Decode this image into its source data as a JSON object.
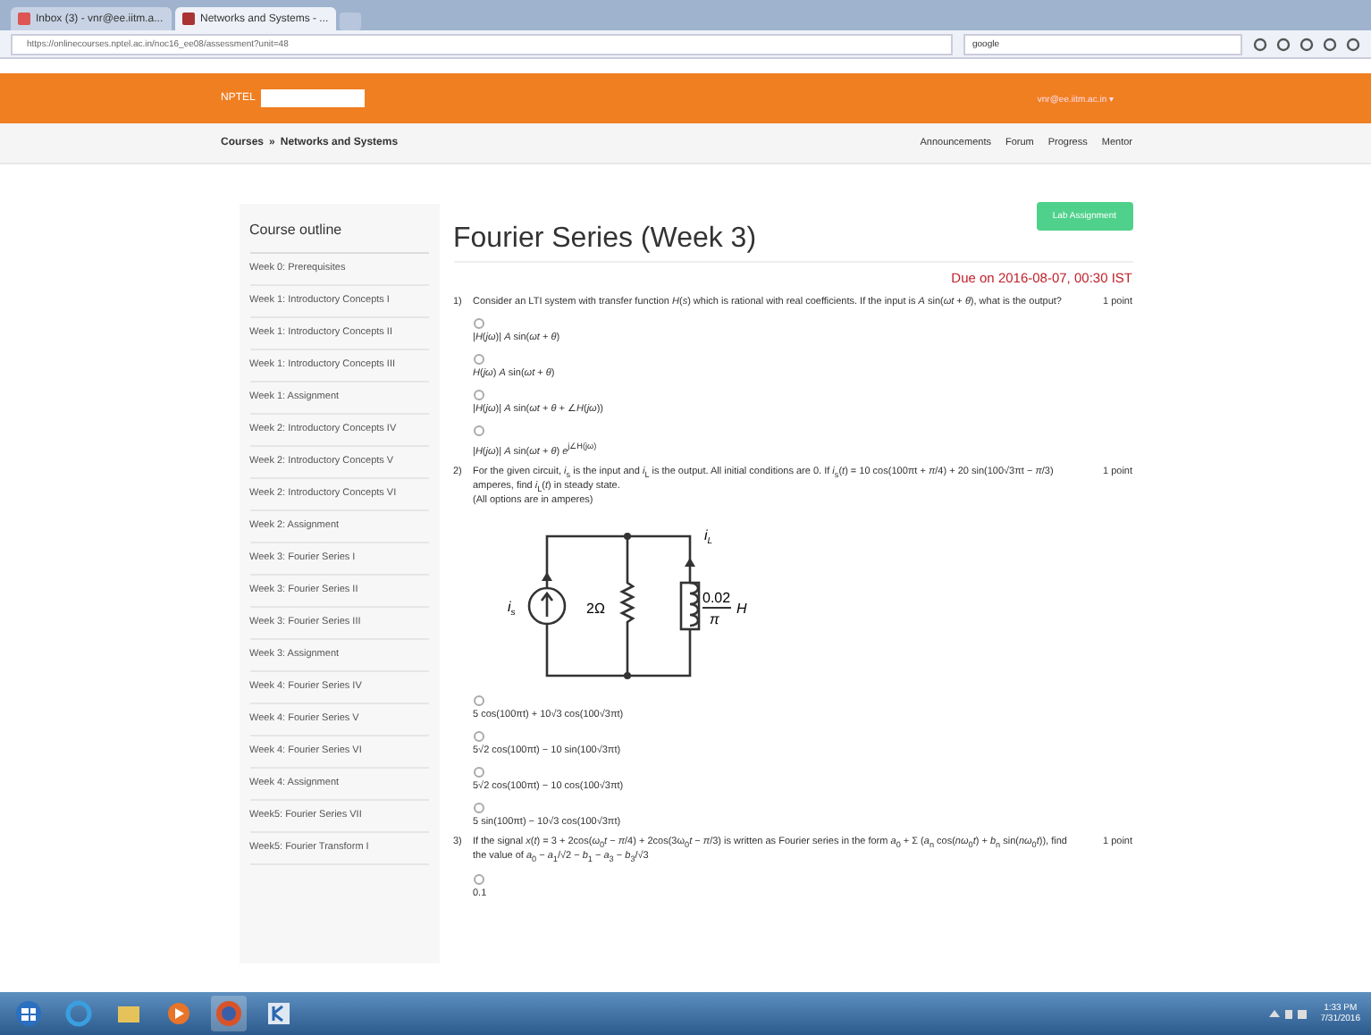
{
  "browser": {
    "tabs": [
      {
        "label": "Inbox (3) - vnr@ee.iitm.a...",
        "selected": false
      },
      {
        "label": "Networks and Systems - ...",
        "selected": true
      }
    ],
    "address": "https://onlinecourses.nptel.ac.in/noc16_ee08/assessment?unit=48",
    "search": "google"
  },
  "site": {
    "brand": "NPTEL",
    "user": "vnr@ee.iitm.ac.in ▾",
    "breadcrumb": [
      "Courses",
      "»",
      "Networks and Systems"
    ],
    "nav": [
      "Announcements",
      "Forum",
      "Progress",
      "Mentor"
    ]
  },
  "sidebar": {
    "title": "Course outline",
    "items": [
      {
        "label": "Week 0: Prerequisites",
        "selected": false
      },
      {
        "label": "Week 1: Introductory Concepts I",
        "selected": false
      },
      {
        "label": "Week 1: Introductory Concepts II",
        "selected": false
      },
      {
        "label": "Week 1: Introductory Concepts III",
        "selected": false
      },
      {
        "label": "Week 1: Assignment",
        "selected": false
      },
      {
        "label": "Week 2: Introductory Concepts IV",
        "selected": false
      },
      {
        "label": "Week 2: Introductory Concepts V",
        "selected": false
      },
      {
        "label": "Week 2: Introductory Concepts VI",
        "selected": false
      },
      {
        "label": "Week 2: Assignment",
        "selected": false
      },
      {
        "label": "Week 3: Fourier Series I",
        "selected": false
      },
      {
        "label": "Week 3: Fourier Series II",
        "selected": false
      },
      {
        "label": "Week 3: Fourier Series III",
        "selected": false
      },
      {
        "label": "Week 3: Assignment",
        "selected": false
      },
      {
        "label": "Week 4: Fourier Series IV",
        "selected": false
      },
      {
        "label": "Week 4: Fourier Series V",
        "selected": false
      },
      {
        "label": "Week 4: Fourier Series VI",
        "selected": false
      },
      {
        "label": "Week 4: Assignment",
        "selected": false
      },
      {
        "label": "Week5: Fourier Series VII",
        "selected": false
      },
      {
        "label": "Week5: Fourier Transform I",
        "selected": false
      }
    ]
  },
  "main": {
    "title": "Fourier Series (Week 3)",
    "action": "Lab Assignment",
    "due": "Due on 2016-08-07, 00:30 IST",
    "questions": [
      {
        "number": "1)",
        "text": "Consider an LTI system with transfer function *H*(*s*) which is rational with real coefficients. If the input is *A* sin(*ωt* + *θ*), what is the output?",
        "points": "1 point",
        "options": [
          {
            "text": "|*H*(*jω*)| *A* sin(*ωt* + *θ*)",
            "selected": false
          },
          {
            "text": "*H*(*jω*) *A* sin(*ωt* + *θ*)",
            "selected": false
          },
          {
            "text": "|*H*(*jω*)| *A* sin(*ωt* + *θ* + ∠*H*(*jω*))",
            "selected": false
          },
          {
            "text": "|*H*(*jω*)| *A* sin(*ωt* + *θ*) *e*$^{j∠H(jω)}$",
            "selected": false
          }
        ]
      },
      {
        "number": "2)",
        "text": "For the given circuit, *i*$_{s}$ is the input and *i*$_{L}$ is the output. All initial conditions are 0. If *i*$_{s}$(*t*) = 10 cos(100πt + *π*/4) + 20 sin(100√3πt − *π*/3) amperes, find *i*$_{L}$(*t*) in steady state.",
        "points": "1 point",
        "notes": [
          "(All options are in amperes)"
        ],
        "circuit": {
          "source": "i$_{s}$",
          "resistor": "2Ω",
          "inductor_num": "0.02",
          "inductor_den": "π",
          "inductor_unit": "H",
          "output": "i$_{L}$"
        },
        "options": [
          {
            "text": "5 cos(100πt) + 10√3 cos(100√3πt)",
            "selected": false
          },
          {
            "text": "5√2 cos(100πt) − 10 sin(100√3πt)",
            "selected": false
          },
          {
            "text": "5√2 cos(100πt) − 10 cos(100√3πt)",
            "selected": false
          },
          {
            "text": "5 sin(100πt) − 10√3 cos(100√3πt)",
            "selected": false
          }
        ]
      },
      {
        "number": "3)",
        "text": "If the signal *x*(*t*) = 3 + 2cos(*ω*$_{0}$*t* − *π*/4) + 2cos(3ω$_{0}$*t* − *π*/3) is written as Fourier series in the form *a*$_{0}$ + Σ (*a*$_{n}$ cos(*nω*$_{0}$*t*) + *b*$_{n}$ sin(*nω*$_{0}$*t*)), find the value of *a*$_{0}$ − *a*$_{1}$/√2 − *b*$_{1}$ − *a*$_{3}$ − *b*$_{3}$/√3",
        "points": "1 point",
        "options": [
          {
            "text": "0.1",
            "selected": false
          }
        ]
      }
    ]
  },
  "taskbar": {
    "time": "1:33 PM",
    "date": "7/31/2016"
  }
}
